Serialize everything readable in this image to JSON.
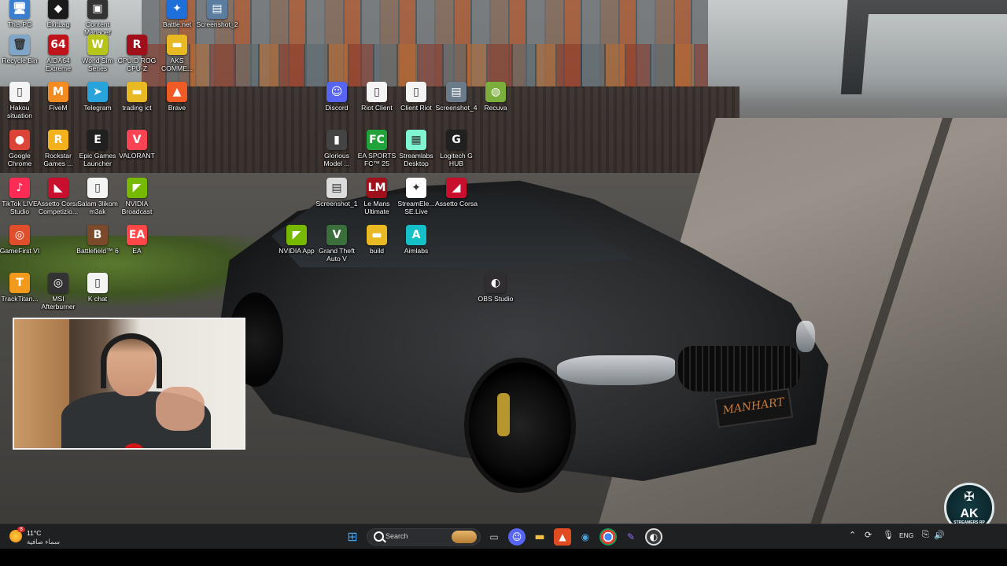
{
  "desktop": {
    "icons": [
      {
        "id": "this-pc",
        "label": "This PC",
        "glyph": "🖥",
        "color": "#3b7fd1"
      },
      {
        "id": "exitlag",
        "label": "ExitLag",
        "glyph": "◆",
        "color": "#1a1a1a"
      },
      {
        "id": "content-manager",
        "label": "Content Manager",
        "glyph": "▣",
        "color": "#333"
      },
      {
        "id": "battlenet",
        "label": "Battle.net",
        "glyph": "✦",
        "color": "#1e6fd9"
      },
      {
        "id": "screenshot-2",
        "label": "Screenshot_2",
        "glyph": "▤",
        "color": "#5a7da0"
      },
      {
        "id": "recycle-bin",
        "label": "Recycle Bin",
        "glyph": "🗑",
        "color": "#7fa6c8"
      },
      {
        "id": "aida64",
        "label": "AIDA64 Extreme",
        "glyph": "64",
        "color": "#c0141b"
      },
      {
        "id": "world-sim",
        "label": "World Sim Series",
        "glyph": "W",
        "color": "#b7c51a"
      },
      {
        "id": "cpuid",
        "label": "CPUID ROG CPU-Z",
        "glyph": "R",
        "color": "#a1101a"
      },
      {
        "id": "aks-comm",
        "label": "AKS COMME...",
        "glyph": "▬",
        "color": "#e8b923"
      },
      {
        "id": "hakou",
        "label": "Hakou situation",
        "glyph": "▯",
        "color": "#f4f4f4"
      },
      {
        "id": "fivem",
        "label": "FiveM",
        "glyph": "M",
        "color": "#f28b20"
      },
      {
        "id": "telegram",
        "label": "Telegram",
        "glyph": "➤",
        "color": "#29a3dc"
      },
      {
        "id": "trading-ict",
        "label": "trading ict",
        "glyph": "▬",
        "color": "#e8b923"
      },
      {
        "id": "brave",
        "label": "Brave",
        "glyph": "▲",
        "color": "#f05a24"
      },
      {
        "id": "discord",
        "label": "Discord",
        "glyph": "☺",
        "color": "#5865f2"
      },
      {
        "id": "riot-client",
        "label": "Riot Client",
        "glyph": "▯",
        "color": "#f4f4f4"
      },
      {
        "id": "client-riot",
        "label": "Client Riot",
        "glyph": "▯",
        "color": "#f4f4f4"
      },
      {
        "id": "screenshot-4",
        "label": "Screenshot_4",
        "glyph": "▤",
        "color": "#6b7b8a"
      },
      {
        "id": "recuva",
        "label": "Recuva",
        "glyph": "◍",
        "color": "#7cae3b"
      },
      {
        "id": "google-chrome",
        "label": "Google Chrome",
        "glyph": "●",
        "color": "#db4437"
      },
      {
        "id": "rockstar",
        "label": "Rockstar Games ...",
        "glyph": "R",
        "color": "#f3b21b"
      },
      {
        "id": "epic",
        "label": "Epic Games Launcher",
        "glyph": "E",
        "color": "#202020"
      },
      {
        "id": "valorant",
        "label": "VALORANT",
        "glyph": "V",
        "color": "#fa4454"
      },
      {
        "id": "glorious",
        "label": "Glorious Model ...",
        "glyph": "▮",
        "color": "#444"
      },
      {
        "id": "ea-sports-fc",
        "label": "EA SPORTS FC™ 25",
        "glyph": "FC",
        "color": "#1fa33a"
      },
      {
        "id": "streamlabs-desktop",
        "label": "Streamlabs Desktop",
        "glyph": "▦",
        "color": "#80f5d2"
      },
      {
        "id": "logitech-g",
        "label": "Logitech G HUB",
        "glyph": "G",
        "color": "#202020"
      },
      {
        "id": "tiktok-live",
        "label": "TikTok LIVE Studio",
        "glyph": "♪",
        "color": "#fe2c55"
      },
      {
        "id": "assetto-corsa-comp",
        "label": "Assetto Corsa Competizio...",
        "glyph": "◣",
        "color": "#c8102e"
      },
      {
        "id": "salam",
        "label": "Salam 3likom m3ak",
        "glyph": "▯",
        "color": "#f4f4f4"
      },
      {
        "id": "nvidia-broadcast",
        "label": "NVIDIA Broadcast",
        "glyph": "◤",
        "color": "#76b900"
      },
      {
        "id": "screenshot-1",
        "label": "Screenshot_1",
        "glyph": "▤",
        "color": "#dcdcdc"
      },
      {
        "id": "le-mans",
        "label": "Le Mans Ultimate",
        "glyph": "LM",
        "color": "#a0101b"
      },
      {
        "id": "streamelements",
        "label": "StreamEle... SE.Live",
        "glyph": "✦",
        "color": "#fff"
      },
      {
        "id": "assetto-corsa",
        "label": "Assetto Corsa",
        "glyph": "◢",
        "color": "#c8102e"
      },
      {
        "id": "gamefirst",
        "label": "GameFirst VI",
        "glyph": "◎",
        "color": "#e04e2b"
      },
      {
        "id": "battlefield6",
        "label": "Battlefield™ 6",
        "glyph": "B",
        "color": "#7a4a2a"
      },
      {
        "id": "ea",
        "label": "EA",
        "glyph": "EA",
        "color": "#ff4747"
      },
      {
        "id": "nvidia-app",
        "label": "NVIDIA App",
        "glyph": "◤",
        "color": "#76b900"
      },
      {
        "id": "gta5",
        "label": "Grand Theft Auto V",
        "glyph": "V",
        "color": "#3a6e3b"
      },
      {
        "id": "build",
        "label": "build",
        "glyph": "▬",
        "color": "#e8b923"
      },
      {
        "id": "aimlabs",
        "label": "Aimlabs",
        "glyph": "A",
        "color": "#16c0c8"
      },
      {
        "id": "tracktitan",
        "label": "TrackTitan...",
        "glyph": "T",
        "color": "#f29a1c"
      },
      {
        "id": "msi-afterburner",
        "label": "MSI Afterburner",
        "glyph": "◎",
        "color": "#333"
      },
      {
        "id": "k-chat",
        "label": "K chat",
        "glyph": "▯",
        "color": "#f4f4f4"
      },
      {
        "id": "obs-studio",
        "label": "OBS Studio",
        "glyph": "◐",
        "color": "#302e31"
      }
    ]
  },
  "wallpaper": {
    "plate_text": "MANHART"
  },
  "taskbar": {
    "weather_temp": "11°C",
    "weather_desc": "سماء صافية",
    "weather_badge": "8",
    "search_placeholder": "Search",
    "language": "ENG",
    "apps": [
      {
        "id": "start",
        "glyph": "⊞",
        "color": "#3da2f0"
      },
      {
        "id": "task-view",
        "glyph": "▭",
        "color": "#cfcfcf"
      },
      {
        "id": "discord",
        "glyph": "☺",
        "color": "#5865f2"
      },
      {
        "id": "file-explorer",
        "glyph": "▬",
        "color": "#f2c043"
      },
      {
        "id": "apex",
        "glyph": "▲",
        "color": "#e04b22"
      },
      {
        "id": "steam",
        "glyph": "◉",
        "color": "#1b6fa8"
      },
      {
        "id": "chrome",
        "glyph": "●",
        "color": "#db4437"
      },
      {
        "id": "pen",
        "glyph": "✎",
        "color": "#8a5cf0"
      },
      {
        "id": "obs",
        "glyph": "◐",
        "color": "#4a4a4a"
      }
    ]
  },
  "overlay": {
    "brand_top": "AK",
    "brand_bottom": "STREAMERS RP"
  }
}
